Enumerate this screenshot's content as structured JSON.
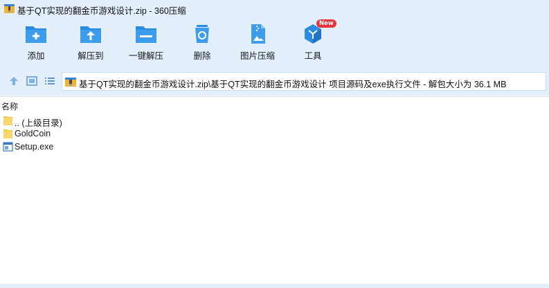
{
  "window": {
    "title": "基于QT实现的翻金币游戏设计.zip - 360压缩"
  },
  "toolbar": {
    "items": [
      {
        "label": "添加",
        "icon": "add-folder-icon"
      },
      {
        "label": "解压到",
        "icon": "extract-to-icon"
      },
      {
        "label": "一键解压",
        "icon": "one-click-extract-icon"
      },
      {
        "label": "删除",
        "icon": "recycle-delete-icon"
      },
      {
        "label": "图片压缩",
        "icon": "image-compress-icon"
      },
      {
        "label": "工具",
        "icon": "tools-cube-icon",
        "badge": "New"
      }
    ]
  },
  "navigation": {
    "path": "基于QT实现的翻金币游戏设计.zip\\基于QT实现的翻金币游戏设计 项目源码及exe执行文件 - 解包大小为 36.1 MB"
  },
  "filelist": {
    "column_name": "名称",
    "items": [
      {
        "name": ".. (上级目录)",
        "icon": "folder-icon"
      },
      {
        "name": "GoldCoin",
        "icon": "folder-icon"
      },
      {
        "name": "Setup.exe",
        "icon": "exe-file-icon"
      }
    ]
  },
  "colors": {
    "toolbar_bg": "#e3f0fc",
    "icon_blue": "#2a8be0",
    "badge_red": "#e8323c",
    "folder_yellow": "#f5c74a"
  }
}
